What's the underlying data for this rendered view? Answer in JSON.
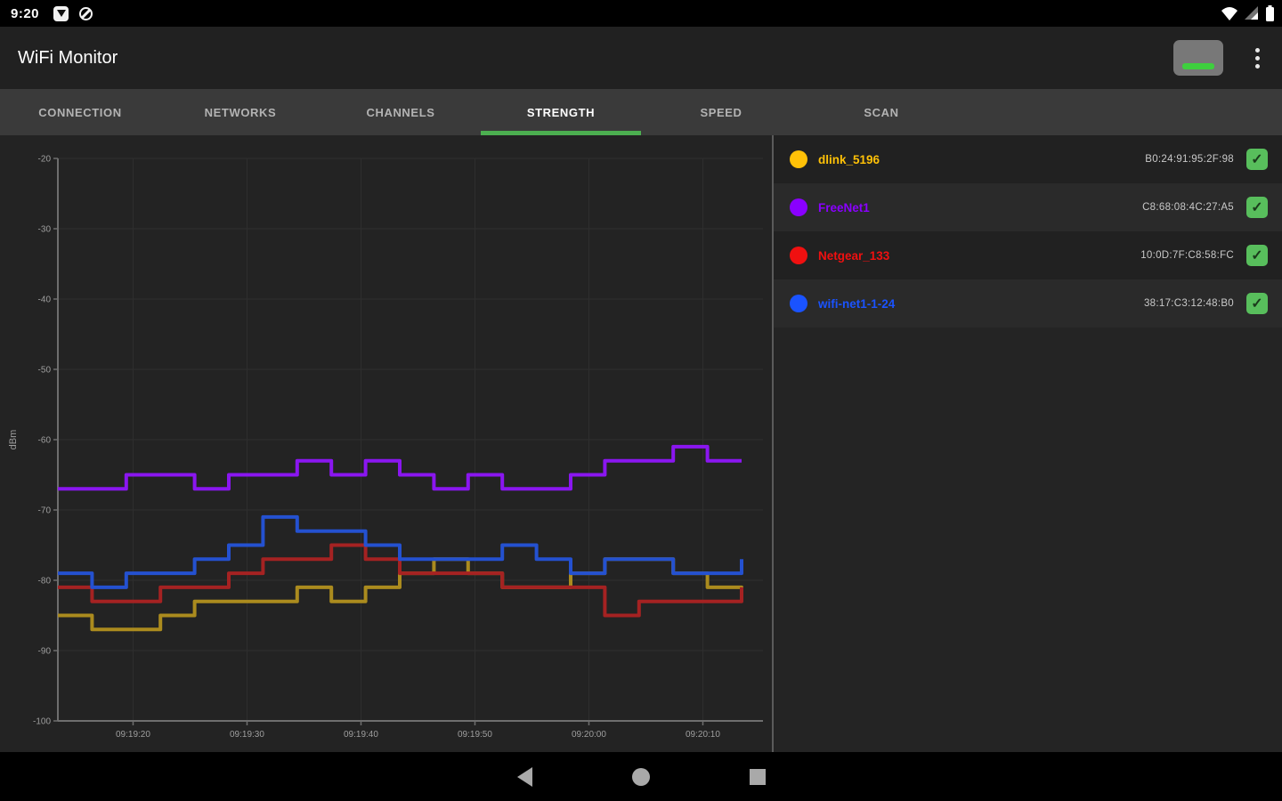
{
  "status_bar": {
    "time": "9:20",
    "left_icons": [
      "adblock-icon",
      "data-saver-icon"
    ],
    "right_icons": [
      "wifi-icon",
      "cell-signal-icon",
      "battery-icon"
    ]
  },
  "app_bar": {
    "title": "WiFi Monitor"
  },
  "tabs": {
    "items": [
      "CONNECTION",
      "NETWORKS",
      "CHANNELS",
      "STRENGTH",
      "SPEED",
      "SCAN"
    ],
    "active": "STRENGTH",
    "active_index": 3,
    "indicator_color": "#4CAF50"
  },
  "networks": [
    {
      "name": "dlink_5196",
      "mac": "B0:24:91:95:2F:98",
      "color": "#FFC107",
      "checked": true
    },
    {
      "name": "FreeNet1",
      "mac": "C8:68:08:4C:27:A5",
      "color": "#8A00FF",
      "checked": true
    },
    {
      "name": "Netgear_133",
      "mac": "10:0D:7F:C8:58:FC",
      "color": "#F01010",
      "checked": true
    },
    {
      "name": "wifi-net1-1-24",
      "mac": "38:17:C3:12:48:B0",
      "color": "#1A53FF",
      "checked": true
    }
  ],
  "chart_data": {
    "type": "line",
    "step": true,
    "title": "",
    "xlabel": "",
    "ylabel": "dBm",
    "ylim": [
      -100,
      -20
    ],
    "yticks": [
      -20,
      -30,
      -40,
      -50,
      -60,
      -70,
      -80,
      -90,
      -100
    ],
    "grid": true,
    "x_span_seconds": 60,
    "x_tick_times": [
      6.6,
      16.6,
      26.6,
      36.6,
      46.6,
      56.6
    ],
    "x_tick_labels": [
      "09:19:20",
      "09:19:30",
      "09:19:40",
      "09:19:50",
      "09:20:00",
      "09:20:10"
    ],
    "sample_interval_seconds": 3,
    "series": [
      {
        "name": "dlink_5196",
        "color": "#ab8b1e",
        "values": [
          -85,
          -87,
          -87,
          -85,
          -83,
          -83,
          -83,
          -81,
          -83,
          -81,
          -79,
          -77,
          -79,
          -81,
          -81,
          -79,
          -77,
          -77,
          -79,
          -81,
          -83
        ]
      },
      {
        "name": "Netgear_133",
        "color": "#a52222",
        "values": [
          -81,
          -83,
          -83,
          -81,
          -81,
          -79,
          -77,
          -77,
          -75,
          -77,
          -79,
          -79,
          -79,
          -81,
          -81,
          -81,
          -85,
          -83,
          -83,
          -83,
          -81
        ]
      },
      {
        "name": "wifi-net1-1-24",
        "color": "#2451d0",
        "values": [
          -79,
          -81,
          -79,
          -79,
          -77,
          -75,
          -71,
          -73,
          -73,
          -75,
          -77,
          -77,
          -77,
          -75,
          -77,
          -79,
          -77,
          -77,
          -79,
          -79,
          -77
        ]
      },
      {
        "name": "FreeNet1",
        "color": "#8a16f0",
        "values": [
          -67,
          -67,
          -65,
          -65,
          -67,
          -65,
          -65,
          -63,
          -65,
          -63,
          -65,
          -67,
          -65,
          -67,
          -67,
          -65,
          -63,
          -63,
          -61,
          -63,
          -63
        ]
      }
    ]
  },
  "nav_bar": {
    "icons": [
      "back-icon",
      "home-icon",
      "recents-icon"
    ]
  }
}
